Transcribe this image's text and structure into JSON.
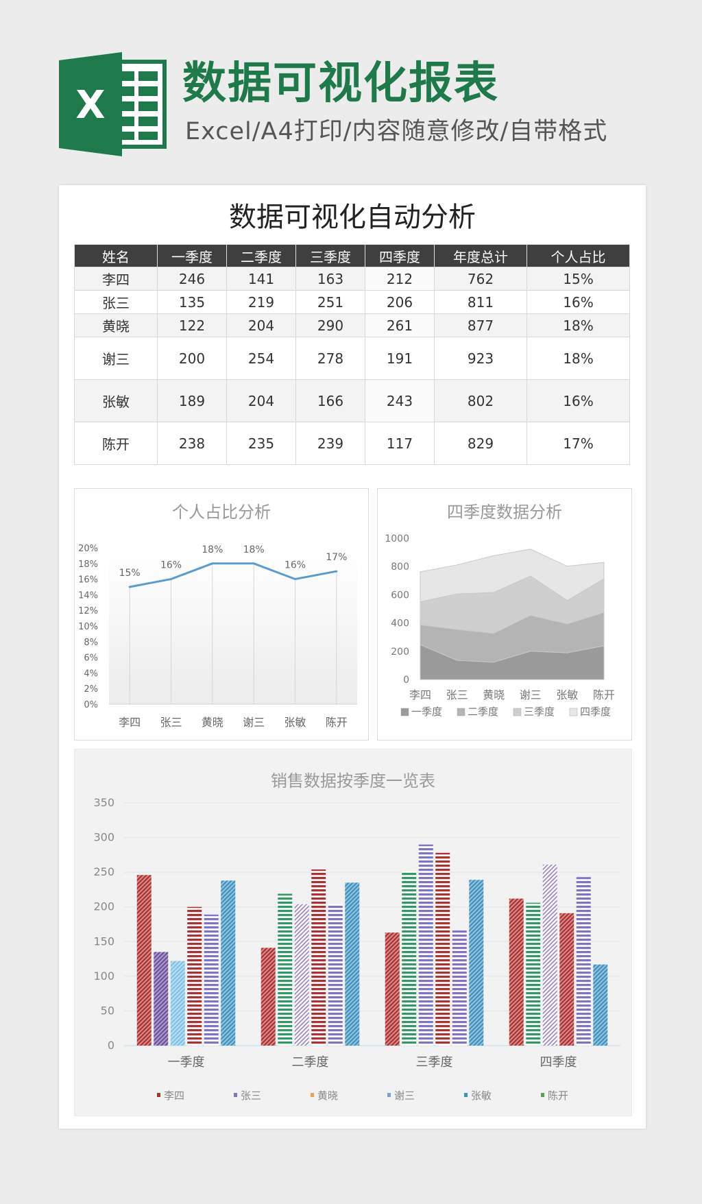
{
  "header": {
    "title": "数据可视化报表",
    "subtitle": "Excel/A4打印/内容随意修改/自带格式",
    "logo_letter": "X"
  },
  "sheet": {
    "title": "数据可视化自动分析",
    "columns": [
      "姓名",
      "一季度",
      "二季度",
      "三季度",
      "四季度",
      "年度总计",
      "个人占比"
    ],
    "rows": [
      [
        "李四",
        "246",
        "141",
        "163",
        "212",
        "762",
        "15%"
      ],
      [
        "张三",
        "135",
        "219",
        "251",
        "206",
        "811",
        "16%"
      ],
      [
        "黄晓",
        "122",
        "204",
        "290",
        "261",
        "877",
        "18%"
      ],
      [
        "谢三",
        "200",
        "254",
        "278",
        "191",
        "923",
        "18%"
      ],
      [
        "张敏",
        "189",
        "204",
        "166",
        "243",
        "802",
        "16%"
      ],
      [
        "陈开",
        "238",
        "235",
        "239",
        "117",
        "829",
        "17%"
      ]
    ]
  },
  "colors": {
    "brand_green": "#1e7a4a",
    "header_dark": "#3f3f3f",
    "line_blue": "#5b9bd5"
  },
  "chart_data": [
    {
      "type": "line",
      "title": "个人占比分析",
      "categories": [
        "李四",
        "张三",
        "黄晓",
        "谢三",
        "张敏",
        "陈开"
      ],
      "values": [
        15,
        16,
        18,
        18,
        16,
        17
      ],
      "data_labels": [
        "15%",
        "16%",
        "18%",
        "18%",
        "16%",
        "17%"
      ],
      "yticks": [
        "0%",
        "2%",
        "4%",
        "6%",
        "8%",
        "10%",
        "12%",
        "14%",
        "16%",
        "18%",
        "20%"
      ],
      "ylim": [
        0,
        20
      ]
    },
    {
      "type": "area",
      "title": "四季度数据分析",
      "stacked": true,
      "categories": [
        "李四",
        "张三",
        "黄晓",
        "谢三",
        "张敏",
        "陈开"
      ],
      "series": [
        {
          "name": "一季度",
          "values": [
            246,
            135,
            122,
            200,
            189,
            238
          ]
        },
        {
          "name": "二季度",
          "values": [
            141,
            219,
            204,
            254,
            204,
            235
          ]
        },
        {
          "name": "三季度",
          "values": [
            163,
            251,
            290,
            278,
            166,
            239
          ]
        },
        {
          "name": "四季度",
          "values": [
            212,
            206,
            261,
            191,
            243,
            117
          ]
        }
      ],
      "yticks": [
        "0",
        "200",
        "400",
        "600",
        "800",
        "1000"
      ],
      "ylim": [
        0,
        1000
      ],
      "legend": "bottom",
      "series_colors": [
        "#9a9a9a",
        "#b4b4b4",
        "#cfcfcf",
        "#e6e6e6"
      ]
    },
    {
      "type": "bar",
      "title": "销售数据按季度一览表",
      "categories": [
        "一季度",
        "二季度",
        "三季度",
        "四季度"
      ],
      "series": [
        {
          "name": "李四",
          "values": [
            246,
            141,
            163,
            212
          ]
        },
        {
          "name": "张三",
          "values": [
            135,
            219,
            251,
            206
          ]
        },
        {
          "name": "黄晓",
          "values": [
            122,
            204,
            290,
            261
          ]
        },
        {
          "name": "谢三",
          "values": [
            200,
            254,
            278,
            191
          ]
        },
        {
          "name": "张敏",
          "values": [
            189,
            204,
            166,
            243
          ]
        },
        {
          "name": "陈开",
          "values": [
            238,
            235,
            239,
            117
          ]
        }
      ],
      "yticks": [
        "0",
        "50",
        "100",
        "150",
        "200",
        "250",
        "300",
        "350"
      ],
      "ylim": [
        0,
        350
      ],
      "legend": "bottom",
      "grid": true
    }
  ]
}
